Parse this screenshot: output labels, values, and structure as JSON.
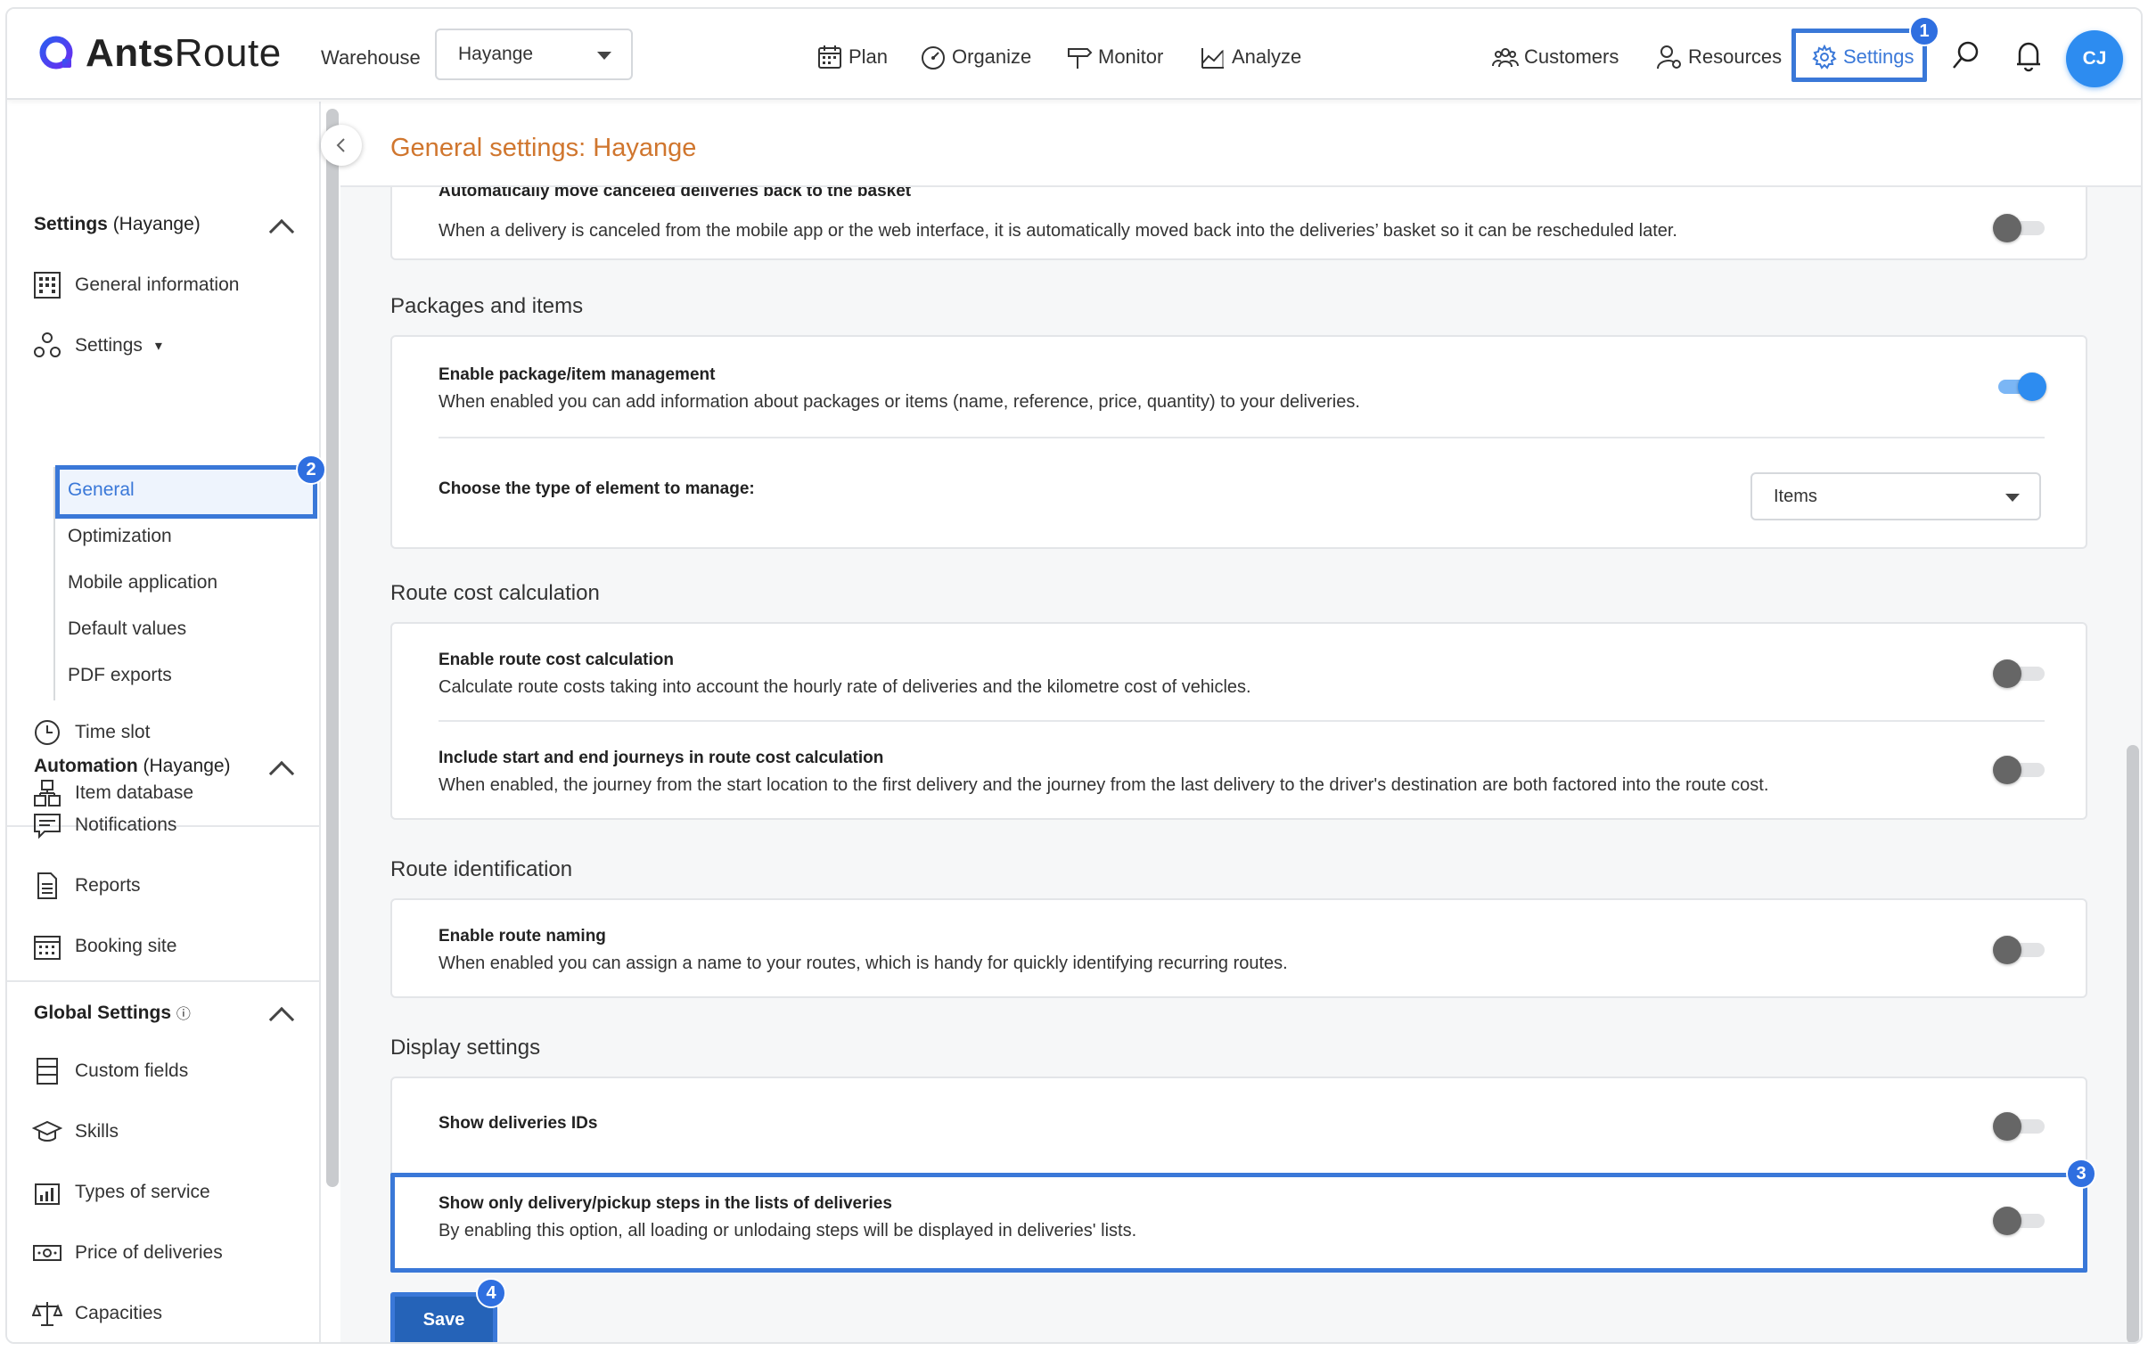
{
  "app": {
    "logo_text_bold": "Ants",
    "logo_text_light": "Route",
    "brand_color": "#3a4de0",
    "accent_color": "#2d8cf0",
    "highlight_color": "#3a78d8"
  },
  "topbar": {
    "warehouse_label": "Warehouse",
    "warehouse_value": "Hayange",
    "nav": [
      {
        "label": "Plan",
        "icon": "calendar-icon"
      },
      {
        "label": "Organize",
        "icon": "speedometer-icon"
      },
      {
        "label": "Monitor",
        "icon": "signpost-icon"
      },
      {
        "label": "Analyze",
        "icon": "chart-icon"
      }
    ],
    "right_nav": [
      {
        "label": "Customers",
        "icon": "customers-icon"
      },
      {
        "label": "Resources",
        "icon": "resources-icon"
      },
      {
        "label": "Settings",
        "icon": "gear-icon"
      }
    ],
    "avatar_initials": "CJ",
    "badges": [
      "1",
      "2",
      "3",
      "4"
    ]
  },
  "sidebar": {
    "settings_section": {
      "title": "Settings",
      "suffix": "(Hayange)"
    },
    "items": {
      "general_information": "General information",
      "settings": "Settings",
      "settings_caret": "▾",
      "time_slot": "Time slot",
      "item_database": "Item database"
    },
    "subitems": [
      "General",
      "Optimization",
      "Mobile application",
      "Default values",
      "PDF exports"
    ],
    "automation_section": {
      "title": "Automation",
      "suffix": "(Hayange)"
    },
    "automation_items": [
      "Notifications",
      "Reports",
      "Booking site"
    ],
    "global_section": {
      "title": "Global Settings",
      "info": "ⓘ"
    },
    "global_items": [
      "Custom fields",
      "Skills",
      "Types of service",
      "Price of deliveries",
      "Capacities"
    ]
  },
  "main": {
    "title": "General settings: Hayange",
    "top_card": {
      "title": "Automatically move canceled deliveries back to the basket",
      "desc": "When a delivery is canceled from the mobile app or the web interface, it is automatically moved back into the deliveries’ basket so it can be rescheduled later.",
      "enabled": false
    },
    "packages": {
      "section": "Packages and items",
      "enable_title": "Enable package/item management",
      "enable_desc": "When enabled you can add information about packages or items (name, reference, price, quantity) to your deliveries.",
      "enabled": true,
      "type_label": "Choose the type of element to manage:",
      "type_value": "Items"
    },
    "route_cost": {
      "section": "Route cost calculation",
      "opt1_title": "Enable route cost calculation",
      "opt1_desc": "Calculate route costs taking into account the hourly rate of deliveries and the kilometre cost of vehicles.",
      "opt2_title": "Include start and end journeys in route cost calculation",
      "opt2_desc": "When enabled, the journey from the start location to the first delivery and the journey from the last delivery to the driver's destination are both factored into the route cost."
    },
    "route_id": {
      "section": "Route identification",
      "opt_title": "Enable route naming",
      "opt_desc": "When enabled you can assign a name to your routes, which is handy for quickly identifying recurring routes."
    },
    "display": {
      "section": "Display settings",
      "opt1_title": "Show deliveries IDs",
      "opt2_title": "Show only delivery/pickup steps in the lists of deliveries",
      "opt2_desc": "By enabling this option, all loading or unlodaing steps will be displayed in deliveries' lists."
    },
    "save_label": "Save"
  }
}
